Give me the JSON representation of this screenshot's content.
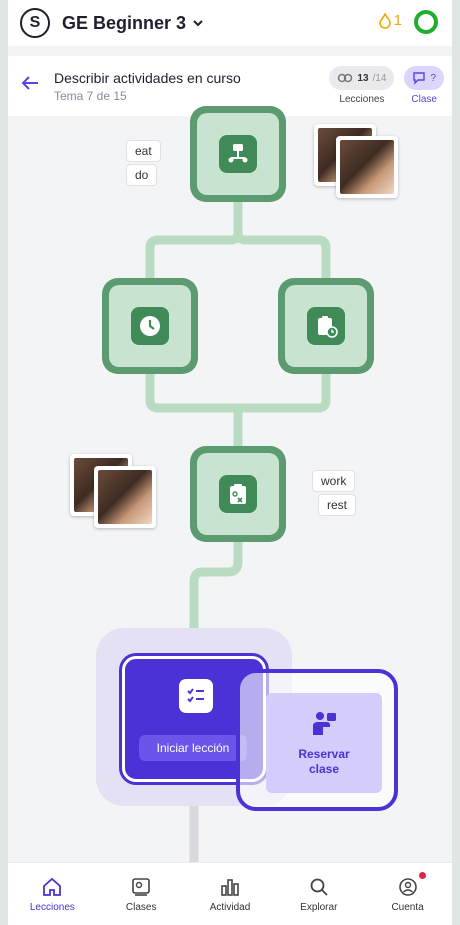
{
  "header": {
    "brand_letter": "S",
    "course_title": "GE Beginner 3",
    "streak_count": "1",
    "streak_color": "#f2a900",
    "progress_color": "#1fae2d"
  },
  "topic": {
    "title": "Describir actividades en curso",
    "subtitle": "Tema 7 de 15",
    "lessons_count": "13",
    "lessons_total": "/14",
    "lessons_label": "Lecciones",
    "class_value": "?",
    "class_label": "Clase"
  },
  "path": {
    "chips_top": [
      "eat",
      "do"
    ],
    "chips_mid": [
      "work",
      "rest"
    ],
    "nodes": [
      {
        "icon": "flowchart-icon",
        "state": "completed"
      },
      {
        "icon": "clock-icon",
        "state": "completed"
      },
      {
        "icon": "clipboard-clock-icon",
        "state": "completed"
      },
      {
        "icon": "clipboard-x-icon",
        "state": "completed"
      }
    ],
    "current": {
      "icon": "checklist-icon",
      "button_label": "Iniciar lección"
    },
    "booking": {
      "label": "Reservar clase",
      "icon": "teacher-icon"
    },
    "colors": {
      "node_border": "#5c9a6f",
      "node_fill": "#c8e3cf",
      "current": "#4a32d6",
      "connector": "#b9dbc2"
    }
  },
  "nav": {
    "items": [
      {
        "label": "Lecciones",
        "icon": "home-icon",
        "active": true
      },
      {
        "label": "Clases",
        "icon": "classes-icon",
        "active": false
      },
      {
        "label": "Actividad",
        "icon": "activity-chart-icon",
        "active": false
      },
      {
        "label": "Explorar",
        "icon": "search-icon",
        "active": false
      },
      {
        "label": "Cuenta",
        "icon": "account-icon",
        "active": false
      }
    ]
  }
}
